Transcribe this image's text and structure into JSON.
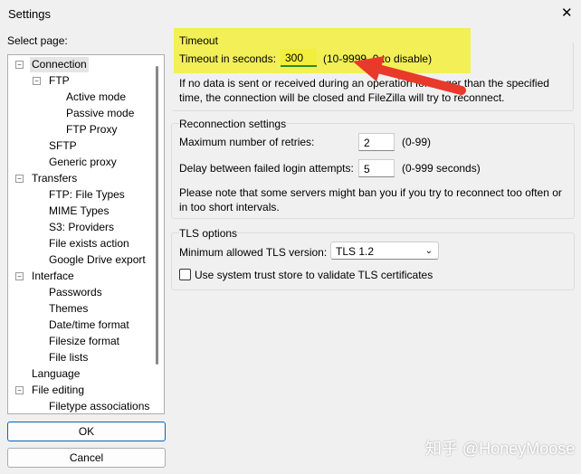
{
  "window": {
    "title": "Settings",
    "close": "✕"
  },
  "sidebar": {
    "label": "Select page:",
    "items": [
      {
        "label": "Connection",
        "level": 0,
        "exp": "−"
      },
      {
        "label": "FTP",
        "level": 1,
        "exp": "−"
      },
      {
        "label": "Active mode",
        "level": 2
      },
      {
        "label": "Passive mode",
        "level": 2
      },
      {
        "label": "FTP Proxy",
        "level": 2
      },
      {
        "label": "SFTP",
        "level": 1
      },
      {
        "label": "Generic proxy",
        "level": 1
      },
      {
        "label": "Transfers",
        "level": 0,
        "exp": "−"
      },
      {
        "label": "FTP: File Types",
        "level": 1
      },
      {
        "label": "MIME Types",
        "level": 1
      },
      {
        "label": "S3: Providers",
        "level": 1
      },
      {
        "label": "File exists action",
        "level": 1
      },
      {
        "label": "Google Drive export",
        "level": 1
      },
      {
        "label": "Interface",
        "level": 0,
        "exp": "−"
      },
      {
        "label": "Passwords",
        "level": 1
      },
      {
        "label": "Themes",
        "level": 1
      },
      {
        "label": "Date/time format",
        "level": 1
      },
      {
        "label": "Filesize format",
        "level": 1
      },
      {
        "label": "File lists",
        "level": 1
      },
      {
        "label": "Language",
        "level": 0
      },
      {
        "label": "File editing",
        "level": 0,
        "exp": "−"
      },
      {
        "label": "Filetype associations",
        "level": 1
      }
    ],
    "ok": "OK",
    "cancel": "Cancel"
  },
  "timeout": {
    "heading": "Timeout",
    "label": "Timeout in seconds:",
    "value": "300",
    "range": "(10-9999, 0 to disable)",
    "note": "If no data is sent or received during an operation for longer than the specified time, the connection will be closed and FileZilla will try to reconnect."
  },
  "reconnect": {
    "heading": "Reconnection settings",
    "retries_label": "Maximum number of retries:",
    "retries": "2",
    "retries_range": "(0-99)",
    "delay_label": "Delay between failed login attempts:",
    "delay": "5",
    "delay_range": "(0-999 seconds)",
    "note": "Please note that some servers might ban you if you try to reconnect too often or in too short intervals."
  },
  "tls": {
    "heading": "TLS options",
    "min_label": "Minimum allowed TLS version:",
    "min_value": "TLS 1.2",
    "trust_label": "Use system trust store to validate TLS certificates",
    "trust_checked": false
  },
  "watermark": "知乎 @HoneyMoose"
}
